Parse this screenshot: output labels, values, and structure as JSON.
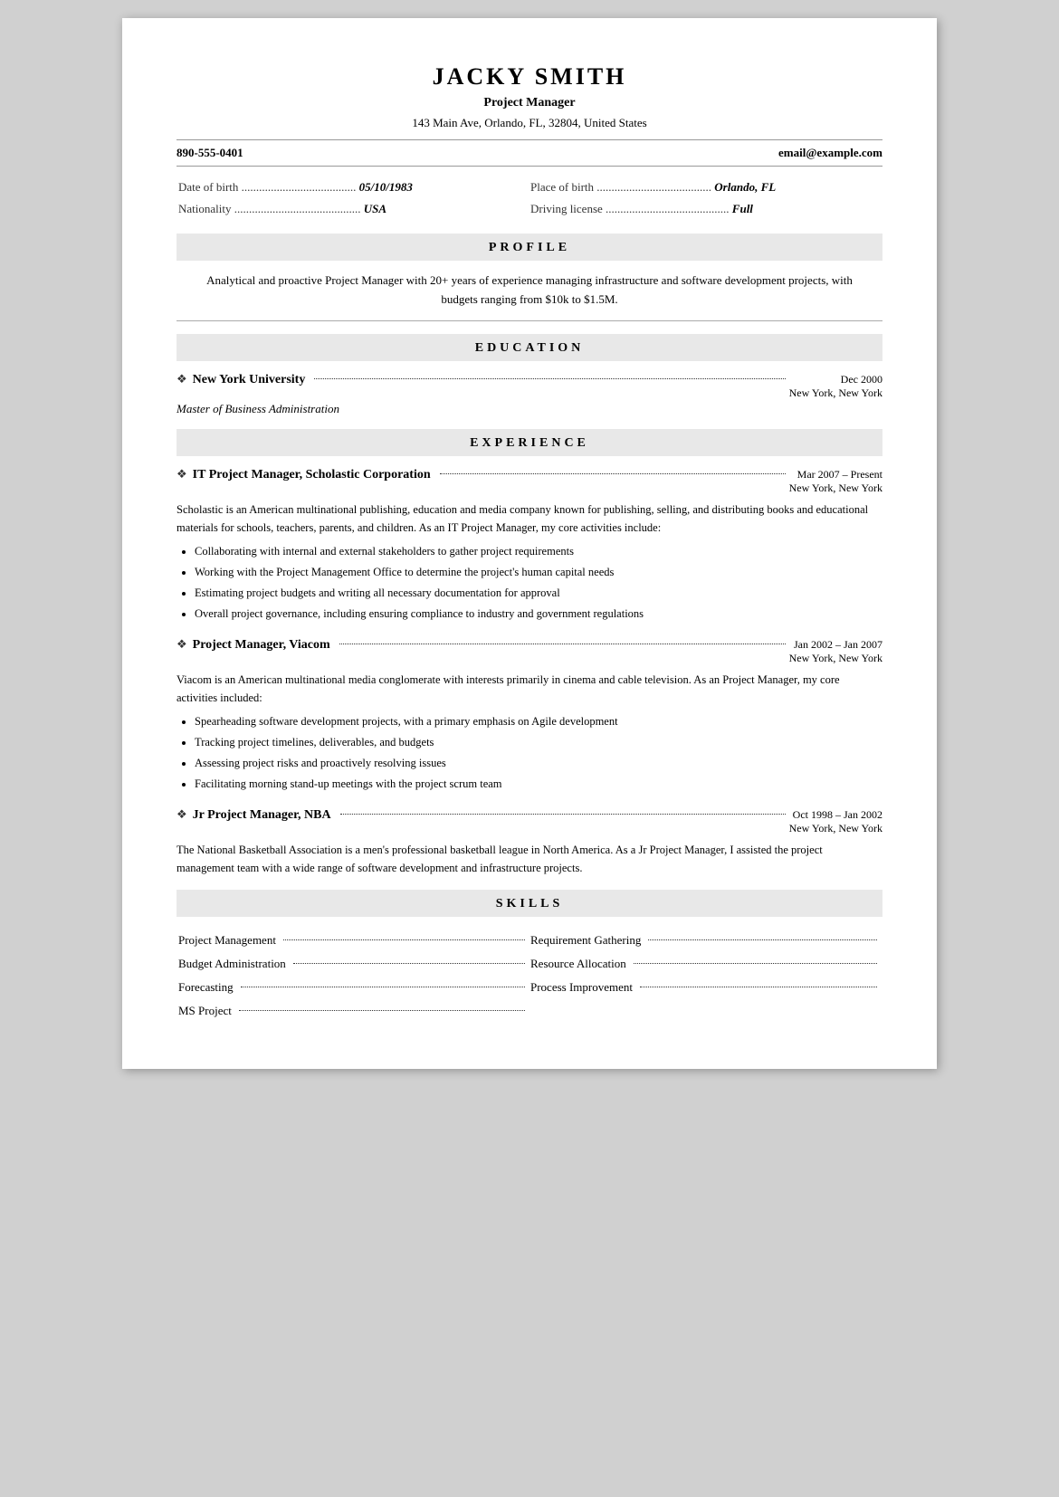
{
  "header": {
    "name": "JACKY SMITH",
    "title": "Project Manager",
    "address": "143 Main Ave, Orlando, FL, 32804, United States",
    "phone": "890-555-0401",
    "email": "email@example.com"
  },
  "personal_info": {
    "date_of_birth_label": "Date of birth",
    "date_of_birth_value": "05/10/1983",
    "place_of_birth_label": "Place of birth",
    "place_of_birth_value": "Orlando, FL",
    "nationality_label": "Nationality",
    "nationality_value": "USA",
    "driving_license_label": "Driving license",
    "driving_license_value": "Full"
  },
  "profile": {
    "section_title": "PROFILE",
    "text": "Analytical and proactive Project Manager with 20+ years of experience managing infrastructure and software development projects, with budgets ranging from $10k to $1.5M."
  },
  "education": {
    "section_title": "EDUCATION",
    "entries": [
      {
        "org": "New York University",
        "degree": "Master of Business Administration",
        "date": "Dec 2000",
        "location": "New York, New York"
      }
    ]
  },
  "experience": {
    "section_title": "EXPERIENCE",
    "entries": [
      {
        "title": "IT Project Manager, Scholastic Corporation",
        "date": "Mar 2007 – Present",
        "location": "New York, New York",
        "description": "Scholastic is an American multinational publishing, education and media company known for publishing, selling, and distributing books and educational materials for schools, teachers, parents, and children. As an IT Project Manager, my core activities include:",
        "bullets": [
          "Collaborating with internal and external stakeholders to gather project requirements",
          "Working with the Project Management Office to determine the project's human capital needs",
          "Estimating project budgets and writing all necessary documentation for approval",
          "Overall project governance, including ensuring compliance to industry and government regulations"
        ]
      },
      {
        "title": "Project Manager, Viacom",
        "date": "Jan 2002 – Jan 2007",
        "location": "New York, New York",
        "description": "Viacom is an American multinational media conglomerate with interests primarily in cinema and cable television. As an Project Manager, my core activities included:",
        "bullets": [
          "Spearheading software development projects, with a primary emphasis on Agile development",
          "Tracking project timelines, deliverables, and budgets",
          "Assessing project risks and proactively resolving issues",
          "Facilitating morning stand-up meetings with the project scrum team"
        ]
      },
      {
        "title": "Jr Project Manager, NBA",
        "date": "Oct 1998 – Jan 2002",
        "location": "New York, New York",
        "description": "The National Basketball Association is a men's professional basketball league in North America. As a Jr Project Manager, I assisted the project management team with a wide range of software development and infrastructure projects.",
        "bullets": []
      }
    ]
  },
  "skills": {
    "section_title": "SKILLS",
    "left_skills": [
      "Project Management",
      "Budget Administration",
      "Forecasting",
      "MS Project"
    ],
    "right_skills": [
      "Requirement Gathering",
      "Resource Allocation",
      "Process Improvement"
    ]
  }
}
